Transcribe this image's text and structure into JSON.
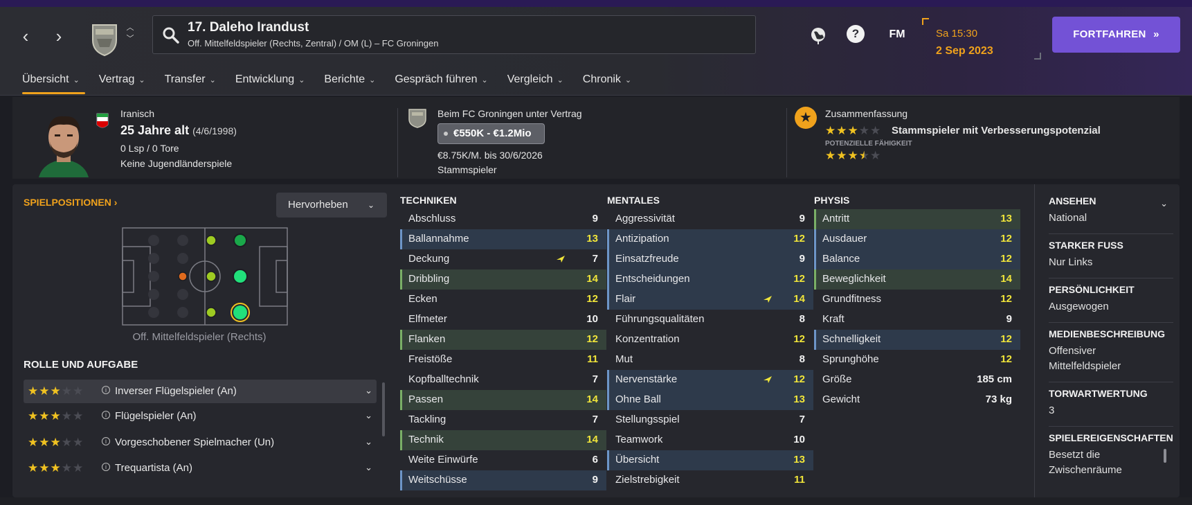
{
  "header": {
    "player_title": "17. Daleho Irandust",
    "player_subtitle": "Off. Mittelfeldspieler (Rechts, Zentral) / OM (L) – FC Groningen",
    "time": "Sa 15:30",
    "date": "2 Sep 2023",
    "fm_label": "FM",
    "help_label": "?",
    "continue_label": "FORTFAHREN"
  },
  "tabs": [
    {
      "label": "Übersicht",
      "active": true
    },
    {
      "label": "Vertrag"
    },
    {
      "label": "Transfer"
    },
    {
      "label": "Entwicklung"
    },
    {
      "label": "Berichte"
    },
    {
      "label": "Gespräch führen"
    },
    {
      "label": "Vergleich"
    },
    {
      "label": "Chronik"
    }
  ],
  "overview": {
    "nationality": "Iranisch",
    "age": "25 Jahre alt",
    "birthdate": "(4/6/1998)",
    "caps": "0 Lsp / 0 Tore",
    "youth_caps": "Keine Jugendländerspiele",
    "contract_club": "Beim FC Groningen unter Vertrag",
    "value": "€550K - €1.2Mio",
    "wage": "€8.75K/M. bis 30/6/2026",
    "status": "Stammspieler",
    "summary_label": "Zusammenfassung",
    "summary_text": "Stammspieler mit Verbesserungspotenzial",
    "current_ability_stars": 3,
    "potential_label": "POTENZIELLE FÄHIGKEIT",
    "potential_ability_stars": 3.5
  },
  "positions": {
    "title": "SPIELPOSITIONEN",
    "highlight_label": "Hervorheben",
    "position_label": "Off. Mittelfeldspieler (Rechts)"
  },
  "roles": {
    "title": "ROLLE UND AUFGABE",
    "items": [
      {
        "name": "Inverser Flügelspieler (An)",
        "stars": 3
      },
      {
        "name": "Flügelspieler (An)",
        "stars": 3
      },
      {
        "name": "Vorgeschobener Spielmacher (Un)",
        "stars": 3
      },
      {
        "name": "Trequartista (An)",
        "stars": 3
      }
    ]
  },
  "technical": {
    "title": "TECHNIKEN",
    "rows": [
      {
        "name": "Abschluss",
        "value": "9",
        "hl": ""
      },
      {
        "name": "Ballannahme",
        "value": "13",
        "hl": "blue"
      },
      {
        "name": "Deckung",
        "value": "7",
        "hl": "",
        "arrow": true
      },
      {
        "name": "Dribbling",
        "value": "14",
        "hl": "green"
      },
      {
        "name": "Ecken",
        "value": "12",
        "hl": ""
      },
      {
        "name": "Elfmeter",
        "value": "10",
        "hl": ""
      },
      {
        "name": "Flanken",
        "value": "12",
        "hl": "green"
      },
      {
        "name": "Freistöße",
        "value": "11",
        "hl": ""
      },
      {
        "name": "Kopfballtechnik",
        "value": "7",
        "hl": ""
      },
      {
        "name": "Passen",
        "value": "14",
        "hl": "green"
      },
      {
        "name": "Tackling",
        "value": "7",
        "hl": ""
      },
      {
        "name": "Technik",
        "value": "14",
        "hl": "green"
      },
      {
        "name": "Weite Einwürfe",
        "value": "6",
        "hl": ""
      },
      {
        "name": "Weitschüsse",
        "value": "9",
        "hl": "blue"
      }
    ]
  },
  "mental": {
    "title": "MENTALES",
    "rows": [
      {
        "name": "Aggressivität",
        "value": "9",
        "hl": ""
      },
      {
        "name": "Antizipation",
        "value": "12",
        "hl": "blue"
      },
      {
        "name": "Einsatzfreude",
        "value": "9",
        "hl": "blue"
      },
      {
        "name": "Entscheidungen",
        "value": "12",
        "hl": "blue"
      },
      {
        "name": "Flair",
        "value": "14",
        "hl": "blue",
        "arrow": true
      },
      {
        "name": "Führungsqualitäten",
        "value": "8",
        "hl": ""
      },
      {
        "name": "Konzentration",
        "value": "12",
        "hl": ""
      },
      {
        "name": "Mut",
        "value": "8",
        "hl": ""
      },
      {
        "name": "Nervenstärke",
        "value": "12",
        "hl": "blue",
        "arrow": true
      },
      {
        "name": "Ohne Ball",
        "value": "13",
        "hl": "blue"
      },
      {
        "name": "Stellungsspiel",
        "value": "7",
        "hl": ""
      },
      {
        "name": "Teamwork",
        "value": "10",
        "hl": ""
      },
      {
        "name": "Übersicht",
        "value": "13",
        "hl": "blue"
      },
      {
        "name": "Zielstrebigkeit",
        "value": "11",
        "hl": ""
      }
    ]
  },
  "physical": {
    "title": "PHYSIS",
    "rows": [
      {
        "name": "Antritt",
        "value": "13",
        "hl": "green"
      },
      {
        "name": "Ausdauer",
        "value": "12",
        "hl": "blue"
      },
      {
        "name": "Balance",
        "value": "12",
        "hl": "blue"
      },
      {
        "name": "Beweglichkeit",
        "value": "14",
        "hl": "green"
      },
      {
        "name": "Grundfitness",
        "value": "12",
        "hl": ""
      },
      {
        "name": "Kraft",
        "value": "9",
        "hl": ""
      },
      {
        "name": "Schnelligkeit",
        "value": "12",
        "hl": "blue"
      },
      {
        "name": "Sprunghöhe",
        "value": "12",
        "hl": ""
      },
      {
        "name": "Größe",
        "value": "185 cm",
        "hl": "",
        "plain": true
      },
      {
        "name": "Gewicht",
        "value": "73 kg",
        "hl": "",
        "plain": true
      }
    ]
  },
  "side": {
    "items": [
      {
        "label": "ANSEHEN",
        "value": "National"
      },
      {
        "label": "STARKER FUSS",
        "value": "Nur Links"
      },
      {
        "label": "PERSÖNLICHKEIT",
        "value": "Ausgewogen"
      },
      {
        "label": "MEDIENBESCHREIBUNG",
        "value": "Offensiver Mittelfeldspieler"
      },
      {
        "label": "TORWARTWERTUNG",
        "value": "3"
      },
      {
        "label": "SPIELEREIGENSCHAFTEN",
        "value": "Besetzt die Zwischenräume"
      }
    ]
  },
  "colors": {
    "accent": "#f0a21c",
    "continue": "#7352d6",
    "value_high": "#f0e53a",
    "highlight_blue": "#6d95c8",
    "highlight_green": "#7ab067"
  }
}
